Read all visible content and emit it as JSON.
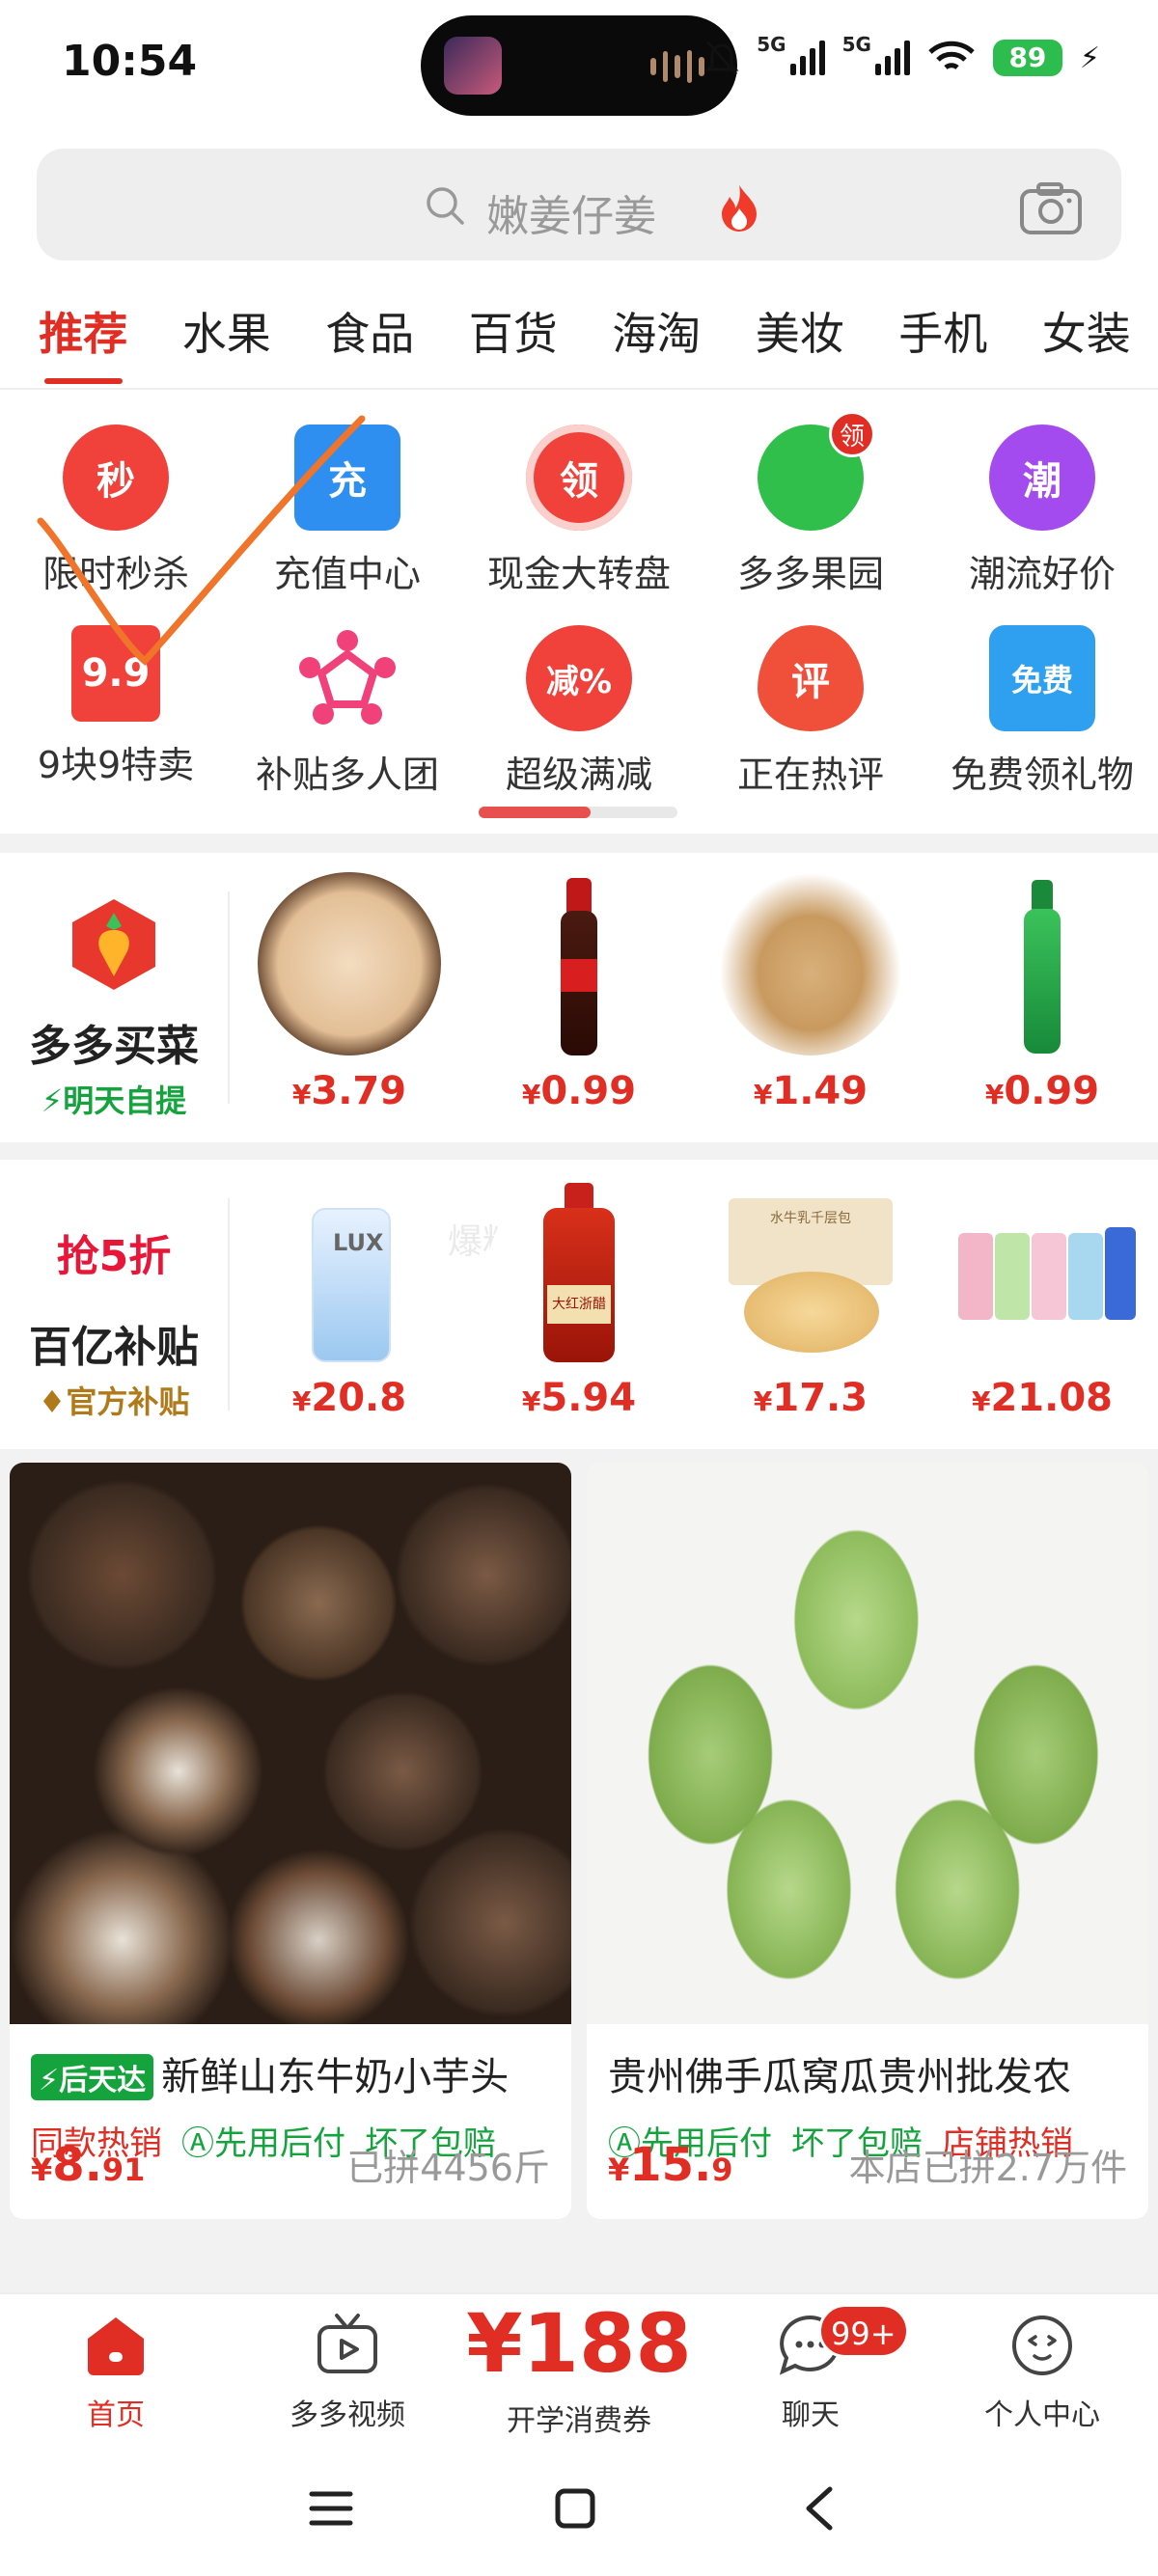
{
  "status_bar": {
    "time": "10:54",
    "net1": "5G",
    "net2": "5G",
    "battery": "89"
  },
  "search": {
    "placeholder": "嫩姜仔姜"
  },
  "tabs": [
    "推荐",
    "水果",
    "食品",
    "百货",
    "海淘",
    "美妆",
    "手机",
    "女装"
  ],
  "grid": {
    "items": [
      {
        "label": "限时秒杀",
        "glyph": "秒",
        "color": "#f0413a"
      },
      {
        "label": "充值中心",
        "glyph": "充",
        "color": "#2f8ff0"
      },
      {
        "label": "现金大转盘",
        "glyph": "领",
        "color": "#f0413a"
      },
      {
        "label": "多多果园",
        "glyph": "",
        "color": "#2fbf4a",
        "badge": "领"
      },
      {
        "label": "潮流好价",
        "glyph": "潮",
        "color": "#a44bf0"
      },
      {
        "label": "9块9特卖",
        "glyph": "9.9",
        "color": "#f0413a"
      },
      {
        "label": "补贴多人团",
        "glyph": "",
        "color": "#f0417a"
      },
      {
        "label": "超级满减",
        "glyph": "减%",
        "color": "#f0413a"
      },
      {
        "label": "正在热评",
        "glyph": "评",
        "color": "#f0503a"
      },
      {
        "label": "免费领礼物",
        "glyph": "免费",
        "color": "#2fa0f0"
      }
    ]
  },
  "maicai": {
    "title": "多多买菜",
    "subtitle": "明天自提",
    "products": [
      {
        "currency": "¥",
        "price": "3.79"
      },
      {
        "currency": "¥",
        "price": "0.99"
      },
      {
        "currency": "¥",
        "price": "1.49"
      },
      {
        "currency": "¥",
        "price": "0.99"
      }
    ]
  },
  "butie": {
    "badge": "抢5折",
    "title": "百亿补贴",
    "subtitle": "官方补贴",
    "watermark": "爆料慢看人",
    "products": [
      {
        "currency": "¥",
        "price": "20.8",
        "brand": "LUX"
      },
      {
        "currency": "¥",
        "price": "5.94",
        "brand": "大红浙醋"
      },
      {
        "currency": "¥",
        "price": "17.3",
        "brand": "水牛乳千层包"
      },
      {
        "currency": "¥",
        "price": "21.08",
        "brand": ""
      }
    ]
  },
  "cards": [
    {
      "flash": "后天达",
      "title": "新鲜山东牛奶小芋头",
      "tags": [
        {
          "text": "同款热销",
          "kind": "red"
        },
        {
          "text": "先用后付",
          "kind": "green"
        },
        {
          "text": "坏了包赔",
          "kind": "green"
        }
      ],
      "currency": "¥",
      "price_int": "8.",
      "price_dec": "91",
      "sold": "已拼4456斤"
    },
    {
      "flash": "",
      "title": "贵州佛手瓜窝瓜贵州批发农",
      "tags": [
        {
          "text": "先用后付",
          "kind": "green"
        },
        {
          "text": "坏了包赔",
          "kind": "green"
        },
        {
          "text": "店铺热销",
          "kind": "red"
        }
      ],
      "currency": "¥",
      "price_int": "15.",
      "price_dec": "9",
      "sold": "本店已拼2.7万件"
    }
  ],
  "bottom_nav": {
    "home": "首页",
    "video": "多多视频",
    "coupon_price": "¥188",
    "coupon_label": "开学消费券",
    "chat": "聊天",
    "chat_badge": "99+",
    "me": "个人中心"
  }
}
